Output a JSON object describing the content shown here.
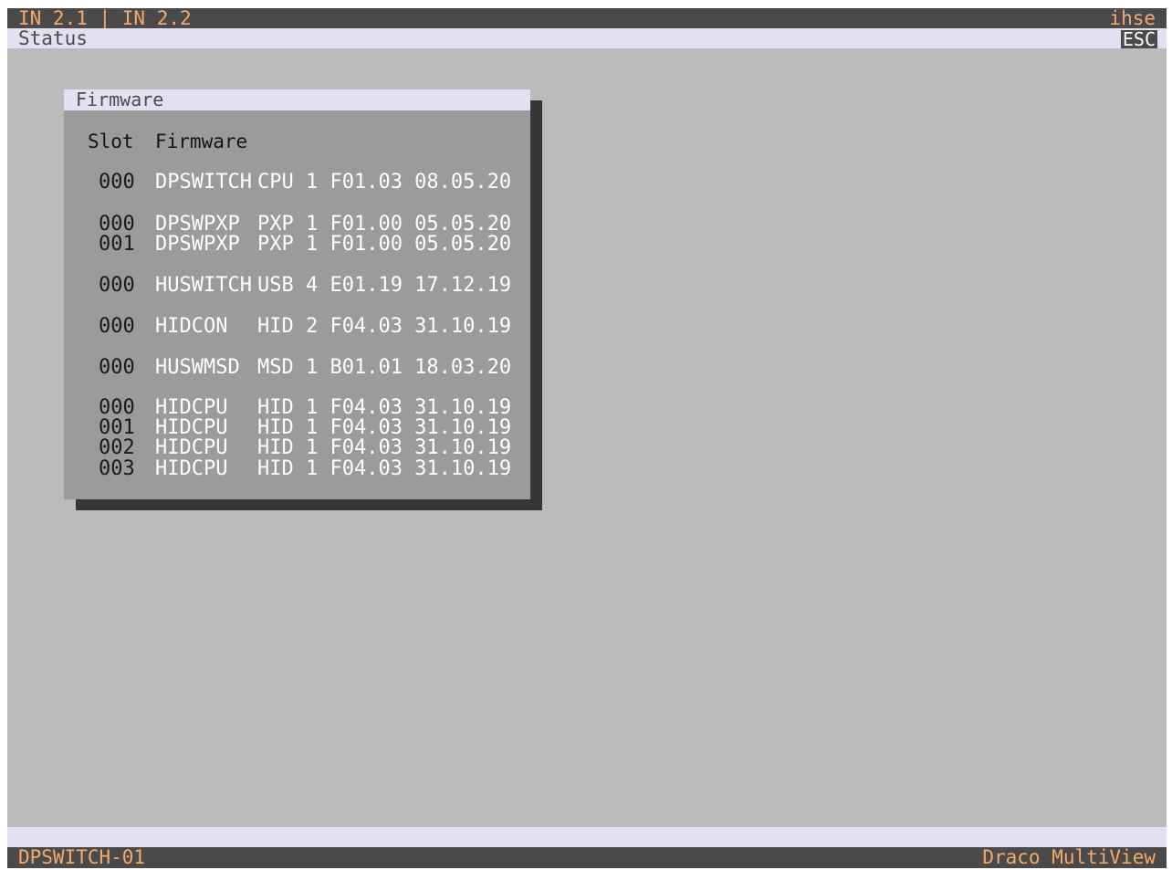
{
  "header": {
    "title": "IN 2.1 | IN 2.2",
    "brand": "ihse"
  },
  "statusbar": {
    "label": "Status",
    "esc_label": "ESC"
  },
  "firmware_window": {
    "title": "Firmware",
    "columns": {
      "slot": "Slot",
      "firmware": "Firmware"
    },
    "rows": [
      {
        "slot": "000",
        "name": "DPSWITCH",
        "version": "CPU 1 F01.03 08.05.20"
      },
      {
        "slot": "000",
        "name": "DPSWPXP",
        "version": "PXP 1 F01.00 05.05.20"
      },
      {
        "slot": "001",
        "name": "DPSWPXP",
        "version": "PXP 1 F01.00 05.05.20"
      },
      {
        "slot": "000",
        "name": "HUSWITCH",
        "version": "USB 4 E01.19 17.12.19"
      },
      {
        "slot": "000",
        "name": "HIDCON",
        "version": "HID 2 F04.03 31.10.19"
      },
      {
        "slot": "000",
        "name": "HUSWMSD",
        "version": "MSD 1 B01.01 18.03.20"
      },
      {
        "slot": "000",
        "name": "HIDCPU",
        "version": "HID 1 F04.03 31.10.19"
      },
      {
        "slot": "001",
        "name": "HIDCPU",
        "version": "HID 1 F04.03 31.10.19"
      },
      {
        "slot": "002",
        "name": "HIDCPU",
        "version": "HID 1 F04.03 31.10.19"
      },
      {
        "slot": "003",
        "name": "HIDCPU",
        "version": "HID 1 F04.03 31.10.19"
      }
    ]
  },
  "footer": {
    "device": "DPSWITCH-01",
    "product": "Draco MultiView"
  }
}
